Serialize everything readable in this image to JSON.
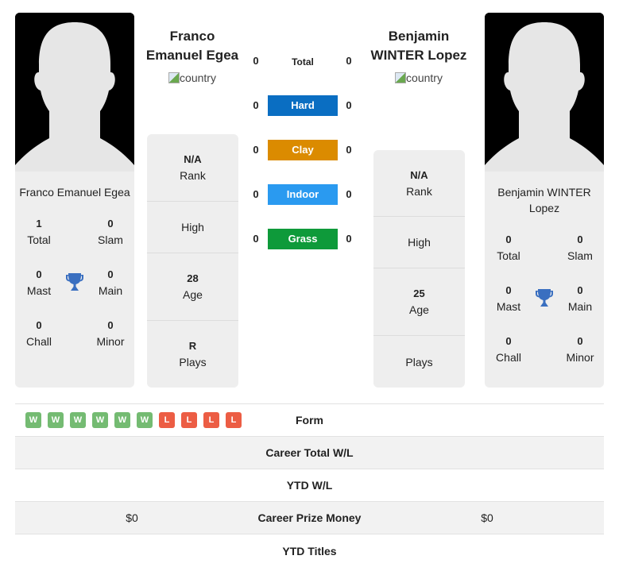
{
  "player1": {
    "name": "Franco Emanuel Egea",
    "header_name_line1": "Franco",
    "header_name_line2": "Emanuel Egea",
    "country_alt": "country",
    "photo_icon": "person-silhouette",
    "titles": {
      "total": {
        "value": "1",
        "label": "Total"
      },
      "slam": {
        "value": "0",
        "label": "Slam"
      },
      "mast": {
        "value": "0",
        "label": "Mast"
      },
      "main": {
        "value": "0",
        "label": "Main"
      },
      "chall": {
        "value": "0",
        "label": "Chall"
      },
      "minor": {
        "value": "0",
        "label": "Minor"
      }
    },
    "info": {
      "rank": {
        "value": "N/A",
        "label": "Rank"
      },
      "high": {
        "value": "",
        "label": "High"
      },
      "age": {
        "value": "28",
        "label": "Age"
      },
      "plays": {
        "value": "R",
        "label": "Plays"
      }
    }
  },
  "player2": {
    "name": "Benjamin WINTER Lopez",
    "header_name_line1": "Benjamin",
    "header_name_line2": "WINTER Lopez",
    "country_alt": "country",
    "photo_icon": "person-silhouette",
    "titles": {
      "total": {
        "value": "0",
        "label": "Total"
      },
      "slam": {
        "value": "0",
        "label": "Slam"
      },
      "mast": {
        "value": "0",
        "label": "Mast"
      },
      "main": {
        "value": "0",
        "label": "Main"
      },
      "chall": {
        "value": "0",
        "label": "Chall"
      },
      "minor": {
        "value": "0",
        "label": "Minor"
      }
    },
    "info": {
      "rank": {
        "value": "N/A",
        "label": "Rank"
      },
      "high": {
        "value": "",
        "label": "High"
      },
      "age": {
        "value": "25",
        "label": "Age"
      },
      "plays": {
        "value": "",
        "label": "Plays"
      }
    }
  },
  "surfaces": [
    {
      "label": "Total",
      "left": "0",
      "right": "0",
      "color": ""
    },
    {
      "label": "Hard",
      "left": "0",
      "right": "0",
      "color": "#0a6ec2"
    },
    {
      "label": "Clay",
      "left": "0",
      "right": "0",
      "color": "#db8b00"
    },
    {
      "label": "Indoor",
      "left": "0",
      "right": "0",
      "color": "#2a9af0"
    },
    {
      "label": "Grass",
      "left": "0",
      "right": "0",
      "color": "#0e9a3a"
    }
  ],
  "form": {
    "label": "Form",
    "results": [
      "W",
      "W",
      "W",
      "W",
      "W",
      "W",
      "L",
      "L",
      "L",
      "L"
    ],
    "win_color": "#74bb72",
    "loss_color": "#ec5d44"
  },
  "stats": [
    {
      "label": "Career Total W/L",
      "left": "",
      "right": ""
    },
    {
      "label": "YTD W/L",
      "left": "",
      "right": ""
    },
    {
      "label": "Career Prize Money",
      "left": "$0",
      "right": "$0"
    },
    {
      "label": "YTD Titles",
      "left": "",
      "right": ""
    }
  ],
  "icons": {
    "trophy": "trophy-icon",
    "country": "broken-image-icon"
  },
  "colors": {
    "trophy": "#3a6fc0",
    "card_bg": "#eeeeee"
  }
}
